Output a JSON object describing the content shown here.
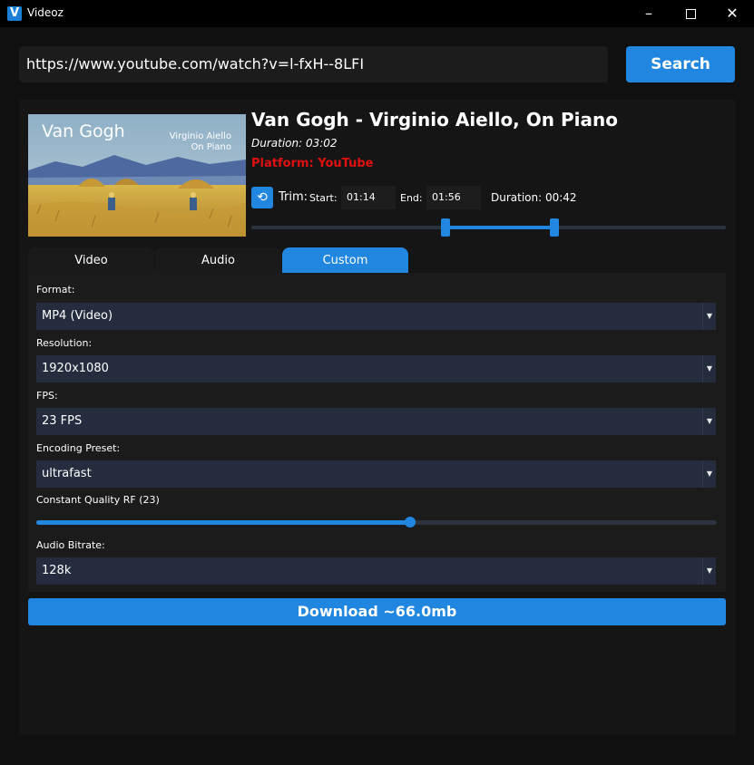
{
  "window": {
    "title": "Videoz",
    "logo_letter": "V"
  },
  "search": {
    "url_value": "https://www.youtube.com/watch?v=l-fxH--8LFI",
    "button_label": "Search"
  },
  "video": {
    "thumbnail_title": "Van Gogh",
    "thumbnail_subtitle_line1": "Virginio Aiello",
    "thumbnail_subtitle_line2": "On Piano",
    "title": "Van Gogh - Virginio Aiello, On Piano",
    "duration": "Duration: 03:02",
    "platform": "Platform: YouTube"
  },
  "trim": {
    "label": "Trim:",
    "start_label": "Start:",
    "start_value": "01:14",
    "end_label": "End:",
    "end_value": "01:56",
    "duration_text": "Duration: 00:42"
  },
  "tabs": [
    {
      "label": "Video",
      "active": false
    },
    {
      "label": "Audio",
      "active": false
    },
    {
      "label": "Custom",
      "active": true
    }
  ],
  "settings": {
    "format": {
      "label": "Format:",
      "value": "MP4 (Video)"
    },
    "resolution": {
      "label": "Resolution:",
      "value": "1920x1080"
    },
    "fps": {
      "label": "FPS:",
      "value": "23 FPS"
    },
    "preset": {
      "label": "Encoding Preset:",
      "value": "ultrafast"
    },
    "quality": {
      "label": "Constant Quality RF (23)",
      "level_fraction": 0.55
    },
    "audio_bitrate": {
      "label": "Audio Bitrate:",
      "value": "128k"
    }
  },
  "download": {
    "label": "Download ~66.0mb"
  },
  "colors": {
    "accent": "#2086e0",
    "platform": "#e01010",
    "background": "#101010"
  }
}
